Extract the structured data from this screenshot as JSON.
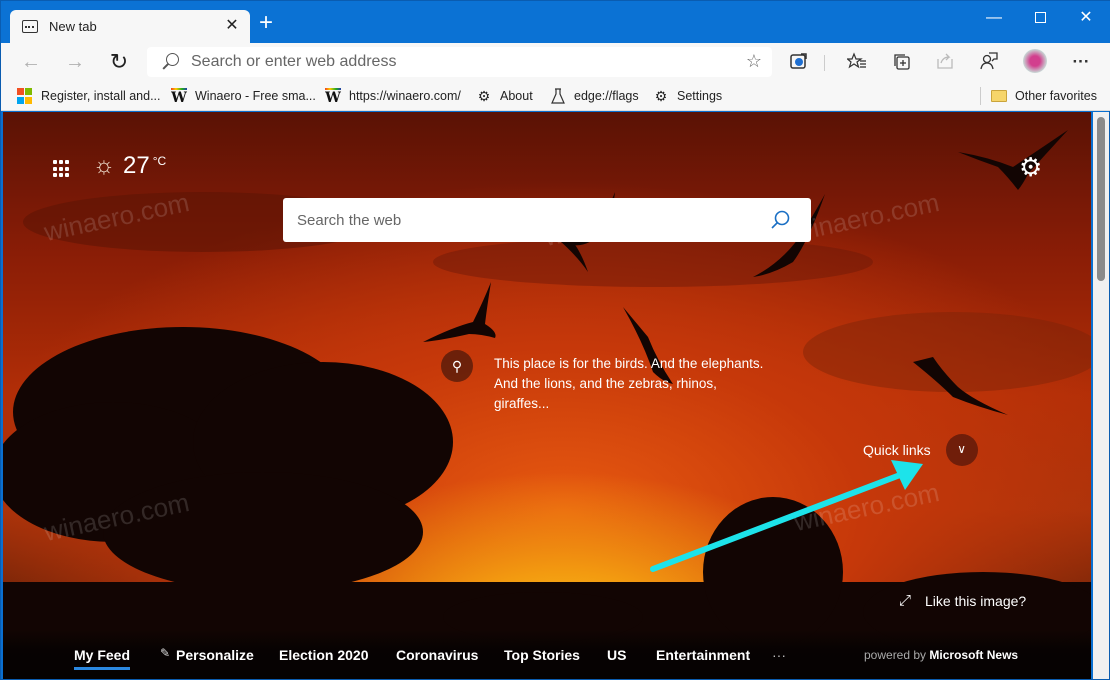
{
  "browser": {
    "tab_title": "New tab",
    "close_tab_glyph": "✕",
    "new_tab_glyph": "+",
    "window_controls": {
      "minimize": "—",
      "close": "✕"
    },
    "nav": {
      "back": "←",
      "forward": "→",
      "reload": "↻"
    },
    "address_placeholder": "Search or enter web address",
    "toolbar_icons": [
      "edge-icon",
      "favorites-icon",
      "collections-icon",
      "share-icon",
      "feedback-icon",
      "profile-avatar",
      "more-icon"
    ],
    "more_glyph": "···",
    "favorites": [
      {
        "label": "Register, install and...",
        "icon": "microsoft-logo"
      },
      {
        "label": "Winaero - Free sma...",
        "icon": "winaero-logo"
      },
      {
        "label": "https://winaero.com/",
        "icon": "winaero-logo"
      },
      {
        "label": "About",
        "icon": "gear-icon"
      },
      {
        "label": "edge://flags",
        "icon": "flask-icon"
      },
      {
        "label": "Settings",
        "icon": "gear-icon"
      }
    ],
    "other_favorites": "Other favorites"
  },
  "newtab": {
    "weather": {
      "temp": "27",
      "unit": "°C",
      "icon": "sun-icon"
    },
    "search_placeholder": "Search the web",
    "fact_text": "This place is for the birds. And the elephants. And the lions, and the zebras, rhinos, giraffes...",
    "quick_links_label": "Quick links",
    "like_image_label": "Like this image?",
    "feed_tabs": [
      {
        "label": "My Feed",
        "active": true
      },
      {
        "label": "Personalize",
        "icon": "pencil-icon"
      },
      {
        "label": "Election 2020"
      },
      {
        "label": "Coronavirus"
      },
      {
        "label": "Top Stories"
      },
      {
        "label": "US"
      },
      {
        "label": "Entertainment"
      },
      {
        "label": "···"
      }
    ],
    "powered_by_prefix": "powered by",
    "powered_by_brand": "Microsoft News"
  },
  "annotation": {
    "arrow_color": "#1de3ea"
  },
  "watermark": "winaero.com",
  "colors": {
    "titlebar": "#0b72d4",
    "accent_underline": "#2b88e0"
  }
}
